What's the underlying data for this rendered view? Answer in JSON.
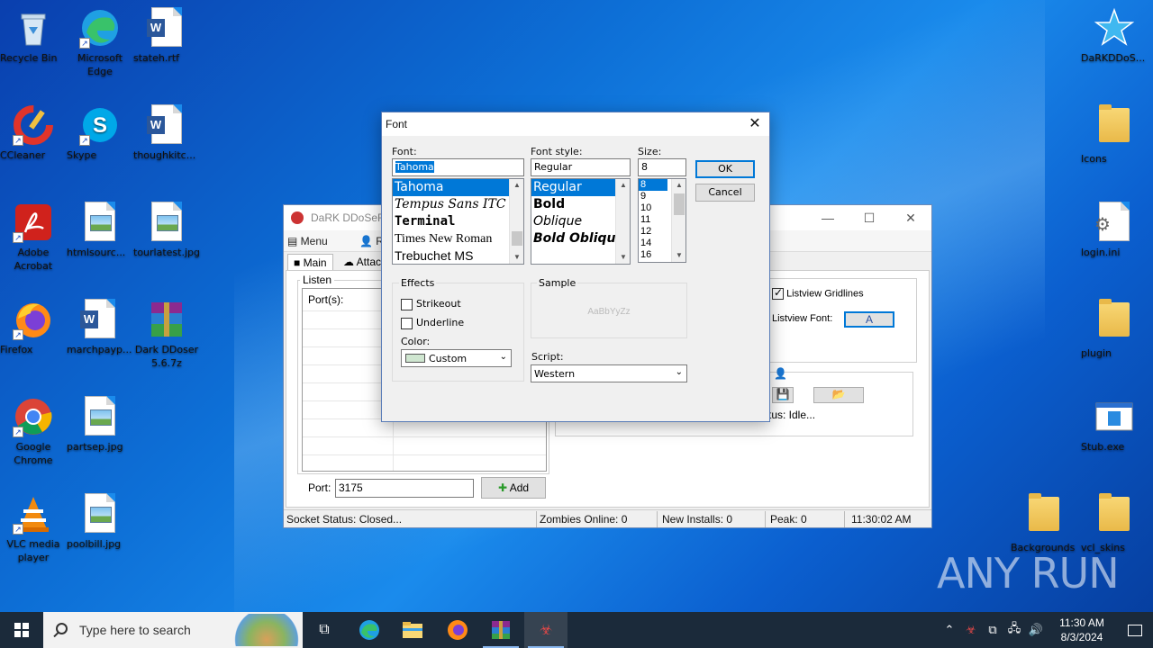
{
  "desktop": {
    "icons_left": [
      {
        "label": "Recycle Bin",
        "icon": "recycle-bin-icon"
      },
      {
        "label": "Microsoft Edge",
        "icon": "edge-icon"
      },
      {
        "label": "stateh.rtf",
        "icon": "word-doc-icon"
      },
      {
        "label": "CCleaner",
        "icon": "ccleaner-icon"
      },
      {
        "label": "Skype",
        "icon": "skype-icon"
      },
      {
        "label": "thoughkitc...",
        "icon": "word-doc-icon"
      },
      {
        "label": "Adobe Acrobat",
        "icon": "acrobat-icon"
      },
      {
        "label": "htmlsourc...",
        "icon": "image-file-icon"
      },
      {
        "label": "tourlatest.jpg",
        "icon": "image-file-icon"
      },
      {
        "label": "Firefox",
        "icon": "firefox-icon"
      },
      {
        "label": "marchpayp...",
        "icon": "word-doc-icon"
      },
      {
        "label": "Dark DDoser 5.6.7z",
        "icon": "winrar-archive-icon"
      },
      {
        "label": "Google Chrome",
        "icon": "chrome-icon"
      },
      {
        "label": "partsep.jpg",
        "icon": "image-file-icon"
      },
      {
        "label": "VLC media player",
        "icon": "vlc-icon"
      },
      {
        "label": "poolbill.jpg",
        "icon": "image-file-icon"
      }
    ],
    "icons_right": [
      {
        "label": "DaRKDDoS...",
        "icon": "star-icon"
      },
      {
        "label": "Icons",
        "icon": "folder-icon"
      },
      {
        "label": "login.ini",
        "icon": "settings-file-icon"
      },
      {
        "label": "plugin",
        "icon": "folder-icon"
      },
      {
        "label": "Stub.exe",
        "icon": "exe-icon"
      },
      {
        "label": "Backgrounds",
        "icon": "folder-icon"
      },
      {
        "label": "vcl_skins",
        "icon": "folder-icon"
      }
    ],
    "watermark": "ANY RUN"
  },
  "app_window": {
    "title": "DaRK DDoSeR v",
    "menu": [
      "Menu",
      "R"
    ],
    "tabs": [
      "Main",
      "Attac"
    ],
    "listen_label": "Listen",
    "ports_header": "Port(s):",
    "port_label": "Port:",
    "port_value": "3175",
    "add_button": "Add",
    "listview_gridlines_label": "Listview Gridlines",
    "listview_gridlines_checked": true,
    "listview_font_label": "Listview Font:",
    "status_partial": "tus: Idle...",
    "statusbar": {
      "socket_status": "Socket Status: Closed...",
      "zombies_online": "Zombies Online: 0",
      "new_installs": "New Installs: 0",
      "peak": "Peak: 0",
      "time": "11:30:02 AM"
    }
  },
  "font_dialog": {
    "title": "Font",
    "font_label": "Font:",
    "font_value": "Tahoma",
    "font_list": [
      "Tahoma",
      "Tempus Sans ITC",
      "Terminal",
      "Times New Roman",
      "Trebuchet MS"
    ],
    "style_label": "Font style:",
    "style_value": "Regular",
    "style_list": [
      "Regular",
      "Bold",
      "Oblique",
      "Bold Oblique"
    ],
    "size_label": "Size:",
    "size_value": "8",
    "size_list": [
      "8",
      "9",
      "10",
      "11",
      "12",
      "14",
      "16"
    ],
    "ok_button": "OK",
    "cancel_button": "Cancel",
    "effects_label": "Effects",
    "strikeout_label": "Strikeout",
    "underline_label": "Underline",
    "color_label": "Color:",
    "color_value": "Custom",
    "color_swatch": "#cfe6d0",
    "sample_label": "Sample",
    "sample_text": "AaBbYyZz",
    "script_label": "Script:",
    "script_value": "Western"
  },
  "taskbar": {
    "search_placeholder": "Type here to search",
    "clock_time": "11:30 AM",
    "clock_date": "8/3/2024"
  }
}
